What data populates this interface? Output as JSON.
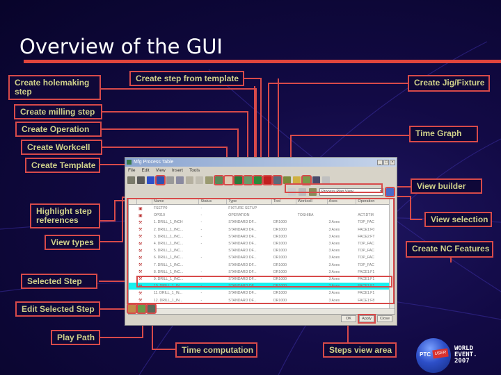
{
  "slide": {
    "title": "Overview of the GUI"
  },
  "callouts": {
    "create_holemaking_step": "Create holemaking\nstep",
    "create_step_from_template": "Create step from template",
    "create_jig_fixture": "Create Jig/Fixture",
    "create_milling_step": "Create milling step",
    "create_operation": "Create Operation",
    "time_graph": "Time Graph",
    "create_workcell": "Create Workcell",
    "create_template": "Create Template",
    "view_builder": "View builder",
    "highlight_step_references": "Highlight step\nreferences",
    "view_selection": "View selection",
    "view_types": "View types",
    "create_nc_features": "Create NC Features",
    "selected_step": "Selected Step",
    "edit_selected_step": "Edit Selected Step",
    "play_path": "Play Path",
    "time_computation": "Time computation",
    "steps_view_area": "Steps view area"
  },
  "window": {
    "title": "Mfg Process Table",
    "controls": [
      "_",
      "□",
      "×"
    ],
    "menu": [
      "File",
      "Edit",
      "View",
      "Insert",
      "Tools"
    ],
    "view_select": "Process Plan View",
    "columns": [
      "",
      "",
      "Name",
      "Status",
      "Type",
      "Tool",
      "Workcell",
      "Axes",
      "Tool",
      "Operation"
    ],
    "rows": [
      {
        "name": "FSETP0",
        "status": "-",
        "type": "FIXTURE SETUP",
        "tool": "",
        "workcell": "",
        "axes": "",
        "ref": ""
      },
      {
        "name": "OP010",
        "status": "-",
        "type": "OPERATION",
        "tool": "",
        "workcell": "TOSHIBA",
        "axes": "",
        "ref": "ACT.DTM"
      },
      {
        "name": "1. DRILL_1_INCH",
        "status": "-",
        "type": "STANDARD DF...",
        "tool": "DR1000",
        "workcell": "",
        "axes": "3 Axes",
        "ref": "TOP_FAC"
      },
      {
        "name": "2. DRILL_1_INC...",
        "status": "-",
        "type": "STANDARD DF...",
        "tool": "DR1000",
        "workcell": "",
        "axes": "3 Axes",
        "ref": "FACE1:F0"
      },
      {
        "name": "3. DRILL_1_INC...",
        "status": "-",
        "type": "STANDARD DF...",
        "tool": "DR1000",
        "workcell": "",
        "axes": "3 Axes",
        "ref": "FACE2:FT"
      },
      {
        "name": "4. DRILL_1_INC...",
        "status": "-",
        "type": "STANDARD DF...",
        "tool": "DR1000",
        "workcell": "",
        "axes": "3 Axes",
        "ref": "TOP_FAC"
      },
      {
        "name": "5. DRILL_1_INC...",
        "status": "",
        "type": "STANDARD DF...",
        "tool": "DR1000",
        "workcell": "",
        "axes": "3 Axes",
        "ref": "TOP_FAC"
      },
      {
        "name": "6. DRILL_1_INC...",
        "status": "-",
        "type": "STANDARD DF...",
        "tool": "DR1000",
        "workcell": "",
        "axes": "3 Axes",
        "ref": "TOP_FAC"
      },
      {
        "name": "7. DRILL_1_INC...",
        "status": "",
        "type": "STANDARD DF...",
        "tool": "DR1000",
        "workcell": "",
        "axes": "3 Axes",
        "ref": "TOP_FAC"
      },
      {
        "name": "8. DRILL_1_INC...",
        "status": "-",
        "type": "STANDARD DF...",
        "tool": "DR1000",
        "workcell": "",
        "axes": "3 Axes",
        "ref": "FACE1:F1"
      },
      {
        "name": "9. DRILL_1_INC...",
        "status": "-",
        "type": "STANDARD DF...",
        "tool": "DR1000",
        "workcell": "",
        "axes": "3 Axes",
        "ref": "FACE1:F1"
      },
      {
        "name": "10. DRILL_1_IN...",
        "status": "-",
        "type": "STANDARD DF...",
        "tool": "DR1000",
        "workcell": "",
        "axes": "3 Axes",
        "ref": "FACE1:F1"
      },
      {
        "name": "11. DRILL_1_IN...",
        "status": "-",
        "type": "STANDARD DF...",
        "tool": "DR1000",
        "workcell": "",
        "axes": "3 Axes",
        "ref": "FACE1:F1"
      },
      {
        "name": "12. DRILL_1_IN...",
        "status": "-",
        "type": "STANDARD DF...",
        "tool": "DR1000",
        "workcell": "",
        "axes": "3 Axes",
        "ref": "FACE1:F8"
      }
    ],
    "selected_row_index": 11,
    "buttons": {
      "ok": "OK",
      "apply": "Apply",
      "close": "Close"
    }
  },
  "logo": {
    "ptc": "PTC",
    "user": "USER",
    "line1": "WORLD",
    "line2": "EVENT.",
    "line3": "2007"
  },
  "colors": {
    "callout_border": "#d74a4a",
    "callout_text": "#cfd08a",
    "selected_row": "#19f0ee",
    "title_rule": "#e0453d"
  }
}
